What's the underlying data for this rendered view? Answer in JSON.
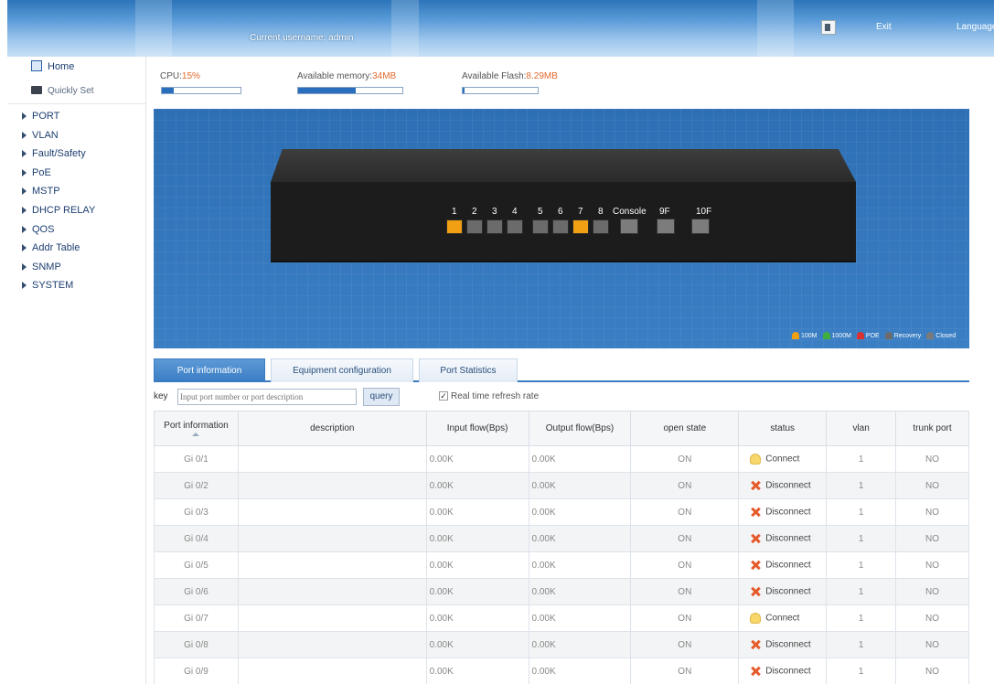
{
  "header": {
    "username_label": "Current username: admin",
    "exit_label": "Exit",
    "language_label": "Language"
  },
  "sidebar": {
    "home": "Home",
    "quick_set": "Quickly Set",
    "items": [
      "PORT",
      "VLAN",
      "Fault/Safety",
      "PoE",
      "MSTP",
      "DHCP RELAY",
      "QOS",
      "Addr Table",
      "SNMP",
      "SYSTEM"
    ]
  },
  "resources": {
    "cpu_label": "CPU:",
    "cpu_value": "15%",
    "cpu_fraction": 0.15,
    "memory_label": "Available memory:",
    "memory_value": "34MB",
    "memory_fraction": 0.55,
    "flash_label": "Available Flash:",
    "flash_value": "8.29MB",
    "flash_fraction": 0.03
  },
  "panel": {
    "ports": [
      {
        "num": "1",
        "active": true
      },
      {
        "num": "2",
        "active": false
      },
      {
        "num": "3",
        "active": false
      },
      {
        "num": "4",
        "active": false
      },
      {
        "num": "5",
        "active": false
      },
      {
        "num": "6",
        "active": false
      },
      {
        "num": "7",
        "active": true
      },
      {
        "num": "8",
        "active": false
      }
    ],
    "console_label": "Console",
    "sfp9_label": "9F",
    "sfp10_label": "10F",
    "legend": [
      {
        "label": "100M",
        "color": "#f0a012"
      },
      {
        "label": "1000M",
        "color": "#3fae3f"
      },
      {
        "label": "POE",
        "color": "#d93030"
      },
      {
        "label": "Recovery",
        "color": "#6b6b6b"
      },
      {
        "label": "Closed",
        "color": "#7a7a7a"
      }
    ]
  },
  "tabs": [
    "Port information",
    "Equipment configuration",
    "Port Statistics"
  ],
  "search": {
    "key_label": "key",
    "placeholder": "Input port number or port description",
    "query_label": "query",
    "refresh_label": "Real time refresh rate",
    "refresh_checked": true
  },
  "table": {
    "headers": [
      "Port information",
      "description",
      "Input flow(Bps)",
      "Output flow(Bps)",
      "open state",
      "status",
      "vlan",
      "trunk port"
    ],
    "rows": [
      {
        "port": "Gi 0/1",
        "description": "",
        "input": "0.00K",
        "output": "0.00K",
        "open": "ON",
        "status": "Connect",
        "vlan": "1",
        "trunk": "NO"
      },
      {
        "port": "Gi 0/2",
        "description": "",
        "input": "0.00K",
        "output": "0.00K",
        "open": "ON",
        "status": "Disconnect",
        "vlan": "1",
        "trunk": "NO"
      },
      {
        "port": "Gi 0/3",
        "description": "",
        "input": "0.00K",
        "output": "0.00K",
        "open": "ON",
        "status": "Disconnect",
        "vlan": "1",
        "trunk": "NO"
      },
      {
        "port": "Gi 0/4",
        "description": "",
        "input": "0.00K",
        "output": "0.00K",
        "open": "ON",
        "status": "Disconnect",
        "vlan": "1",
        "trunk": "NO"
      },
      {
        "port": "Gi 0/5",
        "description": "",
        "input": "0.00K",
        "output": "0.00K",
        "open": "ON",
        "status": "Disconnect",
        "vlan": "1",
        "trunk": "NO"
      },
      {
        "port": "Gi 0/6",
        "description": "",
        "input": "0.00K",
        "output": "0.00K",
        "open": "ON",
        "status": "Disconnect",
        "vlan": "1",
        "trunk": "NO"
      },
      {
        "port": "Gi 0/7",
        "description": "",
        "input": "0.00K",
        "output": "0.00K",
        "open": "ON",
        "status": "Connect",
        "vlan": "1",
        "trunk": "NO"
      },
      {
        "port": "Gi 0/8",
        "description": "",
        "input": "0.00K",
        "output": "0.00K",
        "open": "ON",
        "status": "Disconnect",
        "vlan": "1",
        "trunk": "NO"
      },
      {
        "port": "Gi 0/9",
        "description": "",
        "input": "0.00K",
        "output": "0.00K",
        "open": "ON",
        "status": "Disconnect",
        "vlan": "1",
        "trunk": "NO"
      }
    ]
  }
}
